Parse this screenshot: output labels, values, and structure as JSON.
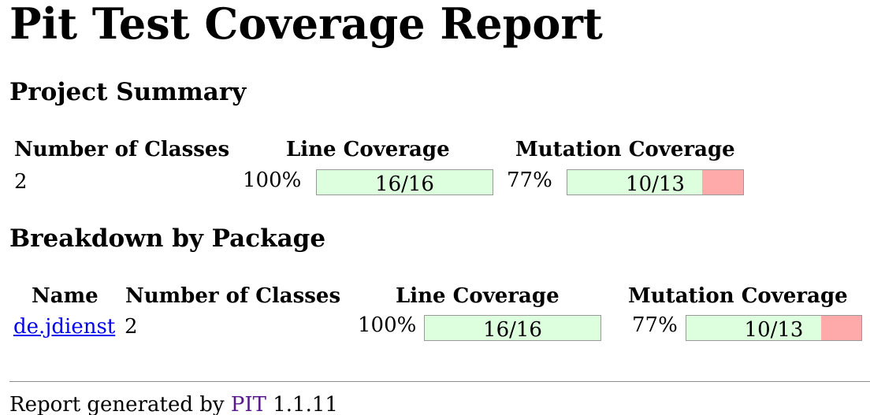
{
  "page_title": "Pit Test Coverage Report",
  "project_summary": {
    "heading": "Project Summary",
    "headers": {
      "classes": "Number of Classes",
      "line": "Line Coverage",
      "mutation": "Mutation Coverage"
    },
    "row": {
      "classes": "2",
      "line_percent": "100%",
      "line_label": "16/16",
      "line_fraction": 1.0,
      "mutation_percent": "77%",
      "mutation_label": "10/13",
      "mutation_fraction": 0.769
    }
  },
  "breakdown": {
    "heading": "Breakdown by Package",
    "headers": {
      "name": "Name",
      "classes": "Number of Classes",
      "line": "Line Coverage",
      "mutation": "Mutation Coverage"
    },
    "rows": [
      {
        "name": "de.jdienst",
        "classes": "2",
        "line_percent": "100%",
        "line_label": "16/16",
        "line_fraction": 1.0,
        "mutation_percent": "77%",
        "mutation_label": "10/13",
        "mutation_fraction": 0.769
      }
    ]
  },
  "footer": {
    "prefix": "Report generated by",
    "link": "PIT",
    "version": "1.1.11"
  },
  "colors": {
    "covered": "#ddffdd",
    "uncovered": "#ffaaaa",
    "link": "#0000ee",
    "visited_link": "#551a8b"
  }
}
